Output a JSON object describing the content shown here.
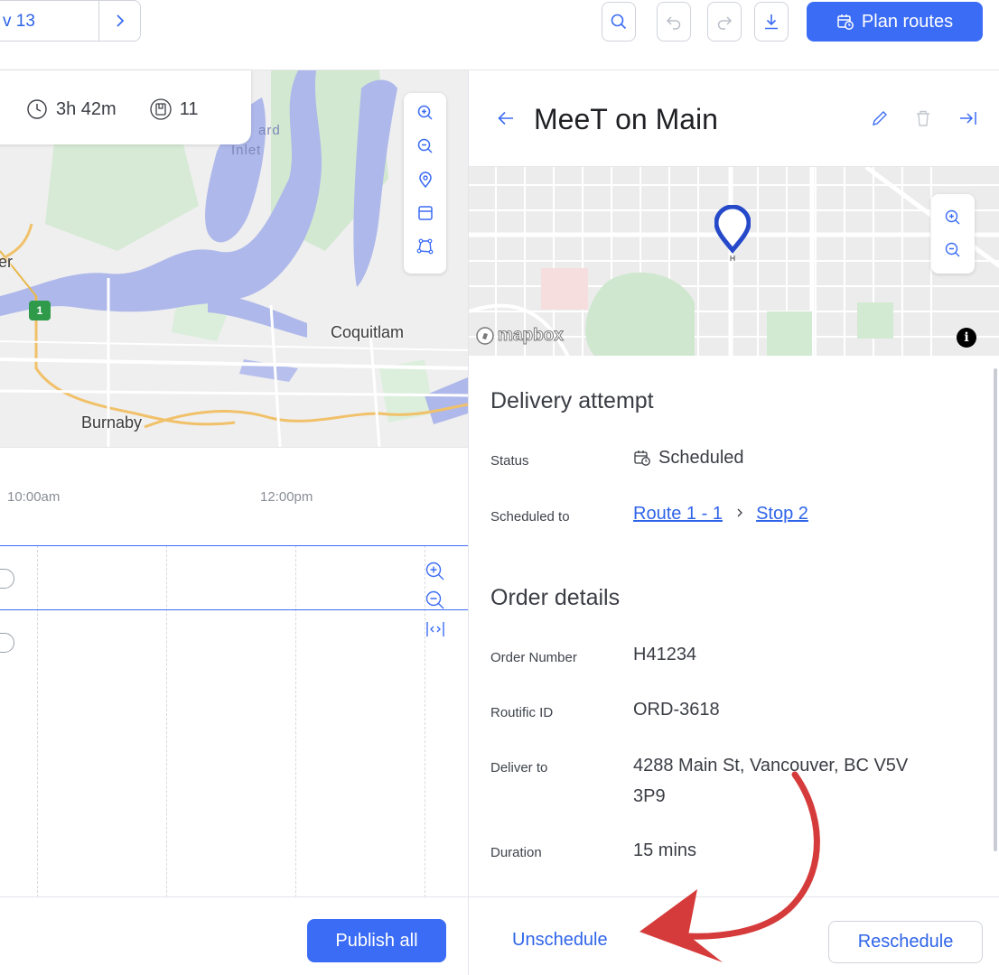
{
  "toolbar": {
    "date_text": "v 13",
    "next_icon": "chevron-right-icon",
    "icons": [
      "search-icon",
      "undo-icon",
      "redo-icon",
      "download-icon"
    ],
    "plan_routes_label": "Plan routes",
    "accent_color": "#3b6cf5"
  },
  "map": {
    "stats": {
      "duration": "3h 42m",
      "stops": "11"
    },
    "labels": {
      "coquitlam": "Coquitlam",
      "burnaby": "Burnaby",
      "er": "er",
      "ard": "ard",
      "inlet": "Inlet"
    },
    "route_badge": "1",
    "tools": [
      "zoom-in-icon",
      "zoom-out-icon",
      "location-pin-icon",
      "layers-icon",
      "draw-polygon-icon"
    ]
  },
  "timeline": {
    "ticks": [
      "10:00am",
      "12:00pm"
    ],
    "tools": [
      "zoom-in-icon",
      "zoom-out-icon",
      "fit-width-icon"
    ],
    "publish_label": "Publish all"
  },
  "detail": {
    "title": "MeeT on Main",
    "header_icons": [
      "back-arrow-icon",
      "edit-pencil-icon",
      "trash-icon",
      "collapse-panel-icon"
    ],
    "map_brand": "mapbox",
    "map_info": "i",
    "delivery_section": "Delivery attempt",
    "status_label": "Status",
    "status_value": "Scheduled",
    "scheduled_to_label": "Scheduled to",
    "route_link": "Route 1 - 1",
    "stop_link": "Stop 2",
    "order_section": "Order details",
    "order_number_label": "Order Number",
    "order_number": "H41234",
    "routific_id_label": "Routific ID",
    "routific_id": "ORD-3618",
    "deliver_to_label": "Deliver to",
    "address_line1": "4288 Main St, Vancouver, BC V5V",
    "address_line2": "3P9",
    "duration_label": "Duration",
    "duration": "15 mins",
    "unschedule_label": "Unschedule",
    "reschedule_label": "Reschedule"
  }
}
